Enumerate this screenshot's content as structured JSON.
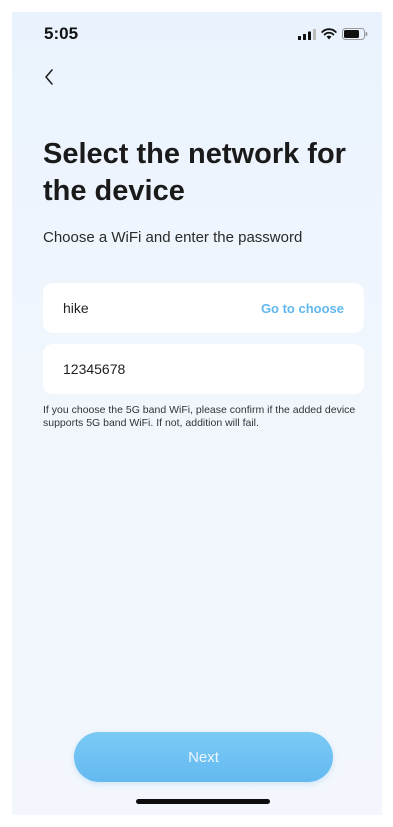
{
  "status_bar": {
    "time": "5:05",
    "icons": [
      "cellular-signal-icon",
      "wifi-icon",
      "battery-icon"
    ]
  },
  "header": {
    "back_icon": "chevron-left-icon"
  },
  "content": {
    "title": "Select the network for the device",
    "subtitle": "Choose a WiFi and enter the password",
    "wifi_field": {
      "value": "hike",
      "action_label": "Go to choose"
    },
    "password_field": {
      "value": "12345678"
    },
    "note": "If you choose the 5G band WiFi, please confirm if the added device supports 5G band WiFi. If not, addition will fail."
  },
  "footer": {
    "next_label": "Next"
  },
  "colors": {
    "accent": "#5fb8ef",
    "button": "#6dc0f2",
    "background": "#eef5fd"
  }
}
